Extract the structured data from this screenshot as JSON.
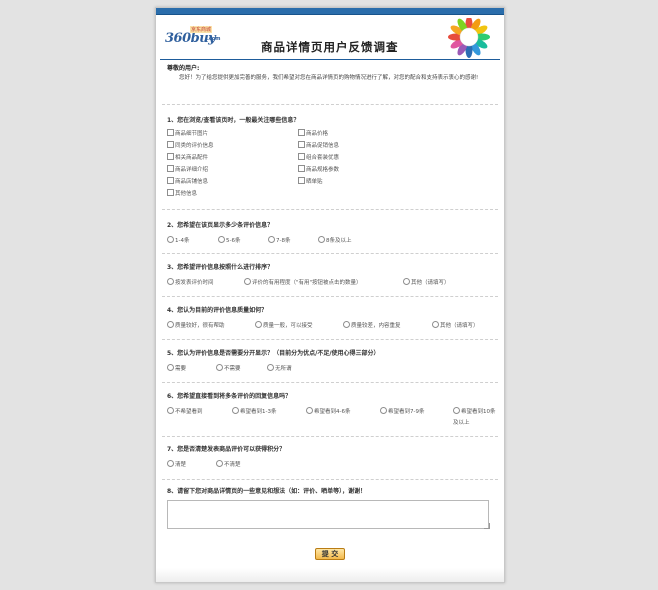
{
  "header": {
    "logo_number": "360buy",
    "logo_tag": "京东商城",
    "logo_domain": ".com",
    "title": "商品详情页用户反馈调查"
  },
  "greeting": "尊敬的用户:",
  "intro": "您好！为了给您提供更加完善的服务，我们希望对您在商品详情页的购物情况进行了解，对您的配合和支持表示衷心的感谢!",
  "questions": [
    {
      "title": "1、您在浏览/查看该页时，一般最关注哪些信息？",
      "options": [
        "商品细节图片",
        "商品价格",
        "同类的评价信息",
        "商品促销信息",
        "相关商品配件",
        "组合套装优惠",
        "商品详细介绍",
        "商品规格参数",
        "商品店铺信息",
        "晒单贴",
        "其他信息"
      ]
    },
    {
      "title": "2、您希望在该页显示多少条评价信息？",
      "options": [
        "1-4条",
        "5-6条",
        "7-8条",
        "8条及以上"
      ]
    },
    {
      "title": "3、您希望评价信息按照什么进行排序？",
      "options": [
        "按发表评价时间",
        "评价的有用程度（\"有用\"按钮被点击的数量）",
        "其他（请填写）"
      ]
    },
    {
      "title": "4、您认为目前的评价信息质量如何？",
      "options": [
        "质量较好，很有帮助",
        "质量一般，可以接受",
        "质量较差，内容重复",
        "其他（请填写）"
      ]
    },
    {
      "title": "5、您认为评价信息是否需要分开显示？（目前分为优点/不足/使用心得三部分）",
      "options": [
        "需要",
        "不需要",
        "无所谓"
      ]
    },
    {
      "title": "6、您希望直接看到将多条评价的回复信息吗？",
      "options": [
        "不希望看到",
        "希望看到1-3条",
        "希望看到4-6条",
        "希望看到7-9条",
        "希望看到10条及以上"
      ]
    },
    {
      "title": "7、您是否清楚发表商品评价可以获得积分？",
      "options": [
        "清楚",
        "不清楚"
      ]
    },
    {
      "title": "8、请留下您对商品详情页的一些意见和想法（如：评价、晒单等），谢谢！",
      "options": []
    }
  ],
  "comment_value": "",
  "submit_label": "提 交"
}
